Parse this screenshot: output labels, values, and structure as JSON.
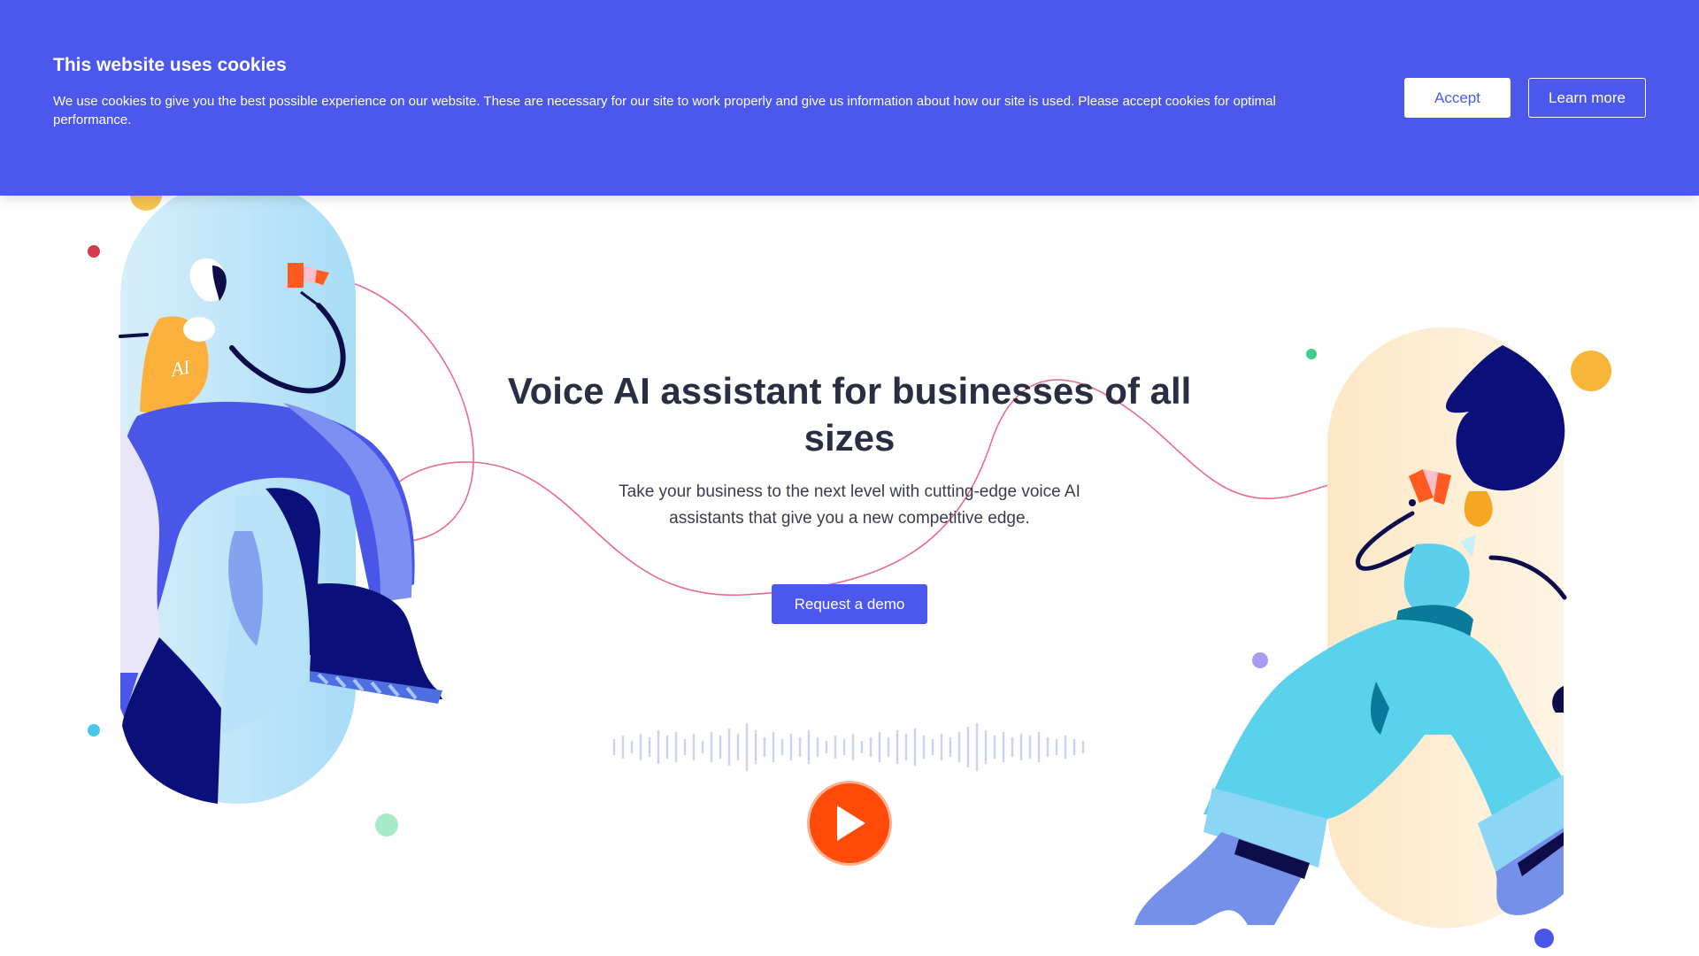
{
  "cookie_banner": {
    "title": "This website uses cookies",
    "text": "We use cookies to give you the best possible experience on our website. These are necessary for our site to work properly and give us information about how our site is used. Please accept cookies for optimal performance.",
    "accept_label": "Accept",
    "learn_more_label": "Learn more"
  },
  "hero": {
    "title": "Voice AI assistant for businesses of all sizes",
    "subtitle": "Take your business to the next level with cutting-edge voice AI assistants that give you a new competitive edge.",
    "cta_label": "Request a demo",
    "figure_left_badge": "AI"
  },
  "colors": {
    "brand": "#4c58ec",
    "accent": "#ff4b0a",
    "text": "#2b2d42"
  },
  "icons": {
    "play": "play-icon"
  }
}
